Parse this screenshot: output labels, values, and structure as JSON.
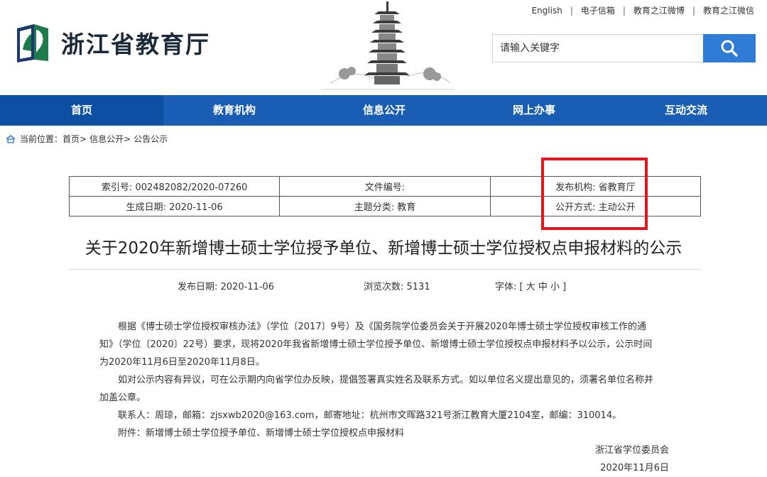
{
  "header": {
    "site_name": "浙江省教育厅",
    "top_links": [
      "English",
      "电子信箱",
      "教育之江微博",
      "教育之江微信"
    ],
    "search_placeholder": "请输入关键字"
  },
  "nav": {
    "items": [
      "首页",
      "教育机构",
      "信息公开",
      "网上办事",
      "互动交流"
    ],
    "active_index": 0
  },
  "breadcrumb": {
    "prefix": "当前位置：",
    "items": [
      "首页>",
      "信息公开>",
      "公告公示"
    ]
  },
  "meta": {
    "index_no": "索引号: 002482082/2020-07260",
    "doc_no": "文件编号:",
    "publisher": "发布机构: 省教育厅",
    "gen_date": "生成日期: 2020-11-06",
    "topic": "主题分类: 教育",
    "open_mode": "公开方式: 主动公开"
  },
  "article": {
    "title": "关于2020年新增博士硕士学位授予单位、新增博士硕士学位授权点申报材料的公示",
    "publish_date": "发布日期: 2020-11-06",
    "views": "浏览次数: 5131",
    "font_label": "字体: [ 大 中 小 ]",
    "para1_line1": "根据《博士硕士学位授权审核办法》（学位〔2017〕9号）及《国务院学位委员会关于开展2020年博士硕士学位授权审核工作的通",
    "para1_line2": "知》（学位〔2020〕22号）要求，现将2020年我省新增博士硕士学位授予单位、新增博士硕士学位授权点申报材料予以公示，公示时间",
    "para1_line3": "为2020年11月6日至2020年11月8日。",
    "para2_line1": "如对公示内容有异议，可在公示期内向省学位办反映，提倡签署真实姓名及联系方式。如以单位名义提出意见的，须署名单位名称并",
    "para2_line2": "加盖公章。",
    "contact": "联系人：周琼，邮箱：zjsxwb2020@163.com，邮寄地址：杭州市文晖路321号浙江教育大厦2104室，邮编：310014。",
    "attachment": "附件：新增博士硕士学位授予单位、新增博士硕士学位授权点申报材料",
    "signer": "浙江省学位委员会",
    "sign_date": "2020年11月6日"
  },
  "colors": {
    "nav_bg": "#1a5db4",
    "search_btn": "#2e7cd6",
    "highlight": "#e3161d"
  }
}
